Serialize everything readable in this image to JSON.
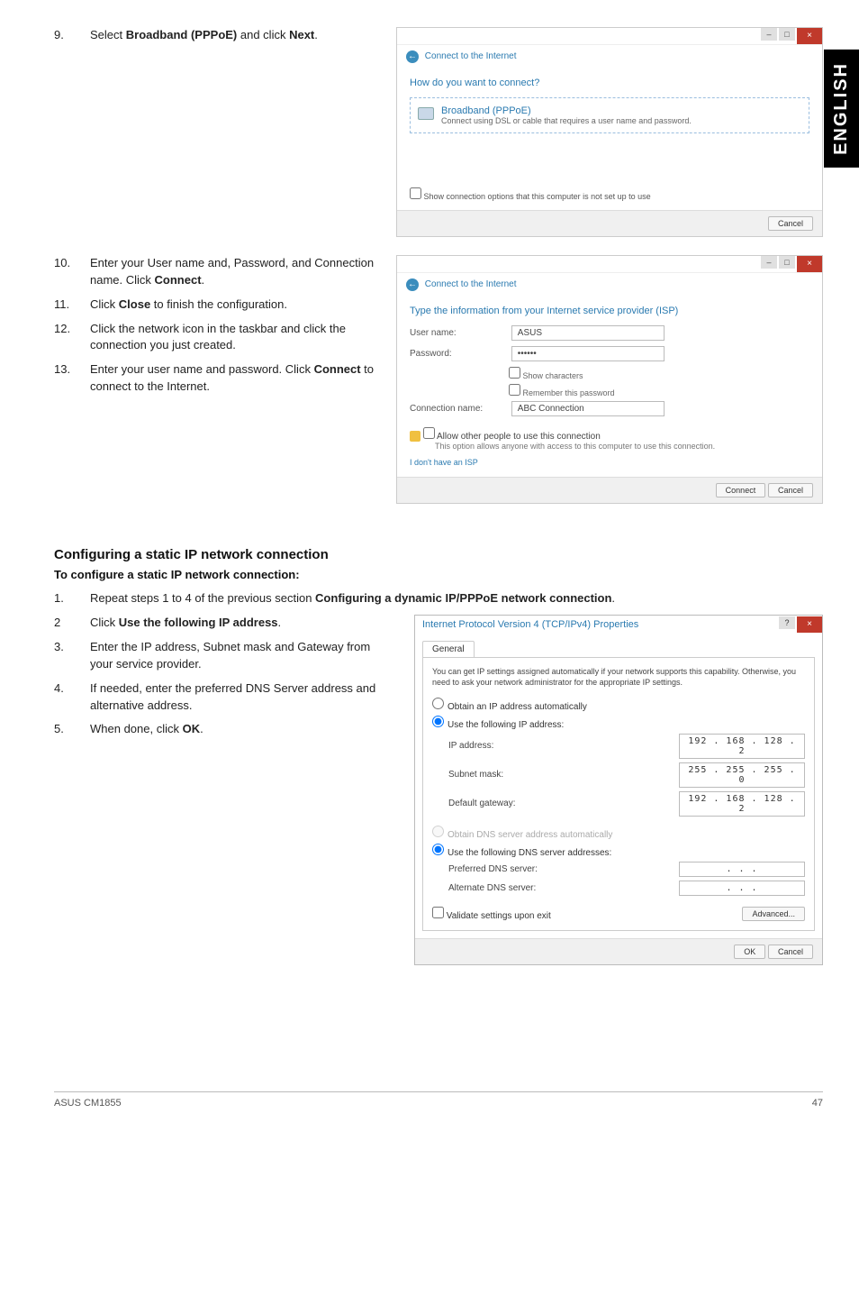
{
  "sideTab": "ENGLISH",
  "step9": {
    "num": "9.",
    "text_pre": "Select ",
    "bold1": "Broadband (PPPoE)",
    "text_mid": " and click ",
    "bold2": "Next",
    "text_post": "."
  },
  "dlgConnect": {
    "back": "←",
    "breadcrumb": "Connect to the Internet",
    "question": "How do you want to connect?",
    "optTitle": "Broadband (PPPoE)",
    "optSub": "Connect using DSL or cable that requires a user name and password.",
    "showOpts": "Show connection options that this computer is not set up to use",
    "cancel": "Cancel"
  },
  "step10": {
    "num": "10.",
    "line1": "Enter your User name and, Password, and Connection name. Click ",
    "bold": "Connect",
    "post": "."
  },
  "step11": {
    "num": "11.",
    "pre": "Click ",
    "bold": "Close",
    "post": " to finish the configuration."
  },
  "step12": {
    "num": "12.",
    "text": "Click the network icon in the taskbar and click the connection you just created."
  },
  "step13": {
    "num": "13.",
    "pre": "Enter your user name and password. Click ",
    "bold": "Connect",
    "post": " to connect to the Internet."
  },
  "dlgIsp": {
    "breadcrumb": "Connect to the Internet",
    "heading": "Type the information from your Internet service provider (ISP)",
    "userLabel": "User name:",
    "userVal": "ASUS",
    "pwdLabel": "Password:",
    "pwdVal": "••••••",
    "showChars": "Show characters",
    "remember": "Remember this password",
    "connLabel": "Connection name:",
    "connVal": "ABC Connection",
    "allow": "Allow other people to use this connection",
    "allowSub": "This option allows anyone with access to this computer to use this connection.",
    "noIsp": "I don't have an ISP",
    "connect": "Connect",
    "cancel": "Cancel"
  },
  "sectionTitle": "Configuring a static IP network connection",
  "sectionSub": "To configure a static IP network connection:",
  "cfg1": {
    "num": "1.",
    "pre": "Repeat steps 1 to 4 of the previous section ",
    "bold": "Configuring a dynamic IP/PPPoE network connection",
    "post": "."
  },
  "cfg2": {
    "num": "2",
    "pre": "Click ",
    "bold": "Use the following IP address",
    "post": "."
  },
  "cfg3": {
    "num": "3.",
    "text": "Enter the IP address, Subnet mask and Gateway from your service provider."
  },
  "cfg4": {
    "num": "4.",
    "text": "If needed, enter the preferred DNS Server address and alternative address."
  },
  "cfg5": {
    "num": "5.",
    "pre": "When done, click ",
    "bold": "OK",
    "post": "."
  },
  "ipv4": {
    "title": "Internet Protocol Version 4 (TCP/IPv4) Properties",
    "help": "?",
    "tab": "General",
    "desc": "You can get IP settings assigned automatically if your network supports this capability. Otherwise, you need to ask your network administrator for the appropriate IP settings.",
    "radioAuto": "Obtain an IP address automatically",
    "radioUse": "Use the following IP address:",
    "ipLabel": "IP address:",
    "ipVal": "192 . 168 . 128 .  2",
    "maskLabel": "Subnet mask:",
    "maskVal": "255 . 255 . 255 .  0",
    "gwLabel": "Default gateway:",
    "gwVal": "192 . 168 . 128 .  2",
    "dnsAuto": "Obtain DNS server address automatically",
    "dnsUse": "Use the following DNS server addresses:",
    "prefLabel": "Preferred DNS server:",
    "prefVal": ".     .     .",
    "altLabel": "Alternate DNS server:",
    "altVal": ".     .     .",
    "validate": "Validate settings upon exit",
    "advanced": "Advanced...",
    "ok": "OK",
    "cancel": "Cancel"
  },
  "footer": {
    "product": "ASUS CM1855",
    "page": "47"
  }
}
